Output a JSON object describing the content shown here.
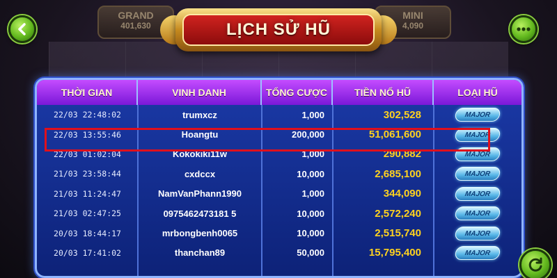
{
  "background": {
    "jackpots": [
      {
        "label": "GRAND",
        "value": "401,630"
      },
      {
        "label": "MINI",
        "value": "4,090"
      }
    ]
  },
  "title": "LỊCH SỬ HŨ",
  "columns": [
    "THỜI GIAN",
    "VINH DANH",
    "TỔNG CƯỢC",
    "TIỀN NỔ HŨ",
    "LOẠI HŨ"
  ],
  "rows": [
    {
      "time": "22/03  22:48:02",
      "name": "trumxcz",
      "bet": "1,000",
      "jackpot": "302,528",
      "type": "MAJOR"
    },
    {
      "time": "22/03  13:55:46",
      "name": "Hoangtu",
      "bet": "200,000",
      "jackpot": "51,061,600",
      "type": "MAJOR"
    },
    {
      "time": "22/03  01:02:04",
      "name": "Kokokiki11w",
      "bet": "1,000",
      "jackpot": "290,882",
      "type": "MAJOR"
    },
    {
      "time": "21/03  23:58:44",
      "name": "cxdccx",
      "bet": "10,000",
      "jackpot": "2,685,100",
      "type": "MAJOR"
    },
    {
      "time": "21/03  11:24:47",
      "name": "NamVanPhann1990",
      "bet": "1,000",
      "jackpot": "344,090",
      "type": "MAJOR"
    },
    {
      "time": "21/03  02:47:25",
      "name": "0975462473181 5",
      "bet": "10,000",
      "jackpot": "2,572,240",
      "type": "MAJOR"
    },
    {
      "time": "20/03  18:44:17",
      "name": "mrbongbenh0065",
      "bet": "10,000",
      "jackpot": "2,515,740",
      "type": "MAJOR"
    },
    {
      "time": "20/03  17:41:02",
      "name": "thanchan89",
      "bet": "50,000",
      "jackpot": "15,795,400",
      "type": "MAJOR"
    }
  ],
  "colors": {
    "panel": "#1b3aa8",
    "header": "#a435f0",
    "jackpot_text": "#ffd21f",
    "highlight": "#e0101c"
  },
  "icons": {
    "back": "chevron-left-icon",
    "more": "ellipsis-icon",
    "refresh": "refresh-icon"
  }
}
